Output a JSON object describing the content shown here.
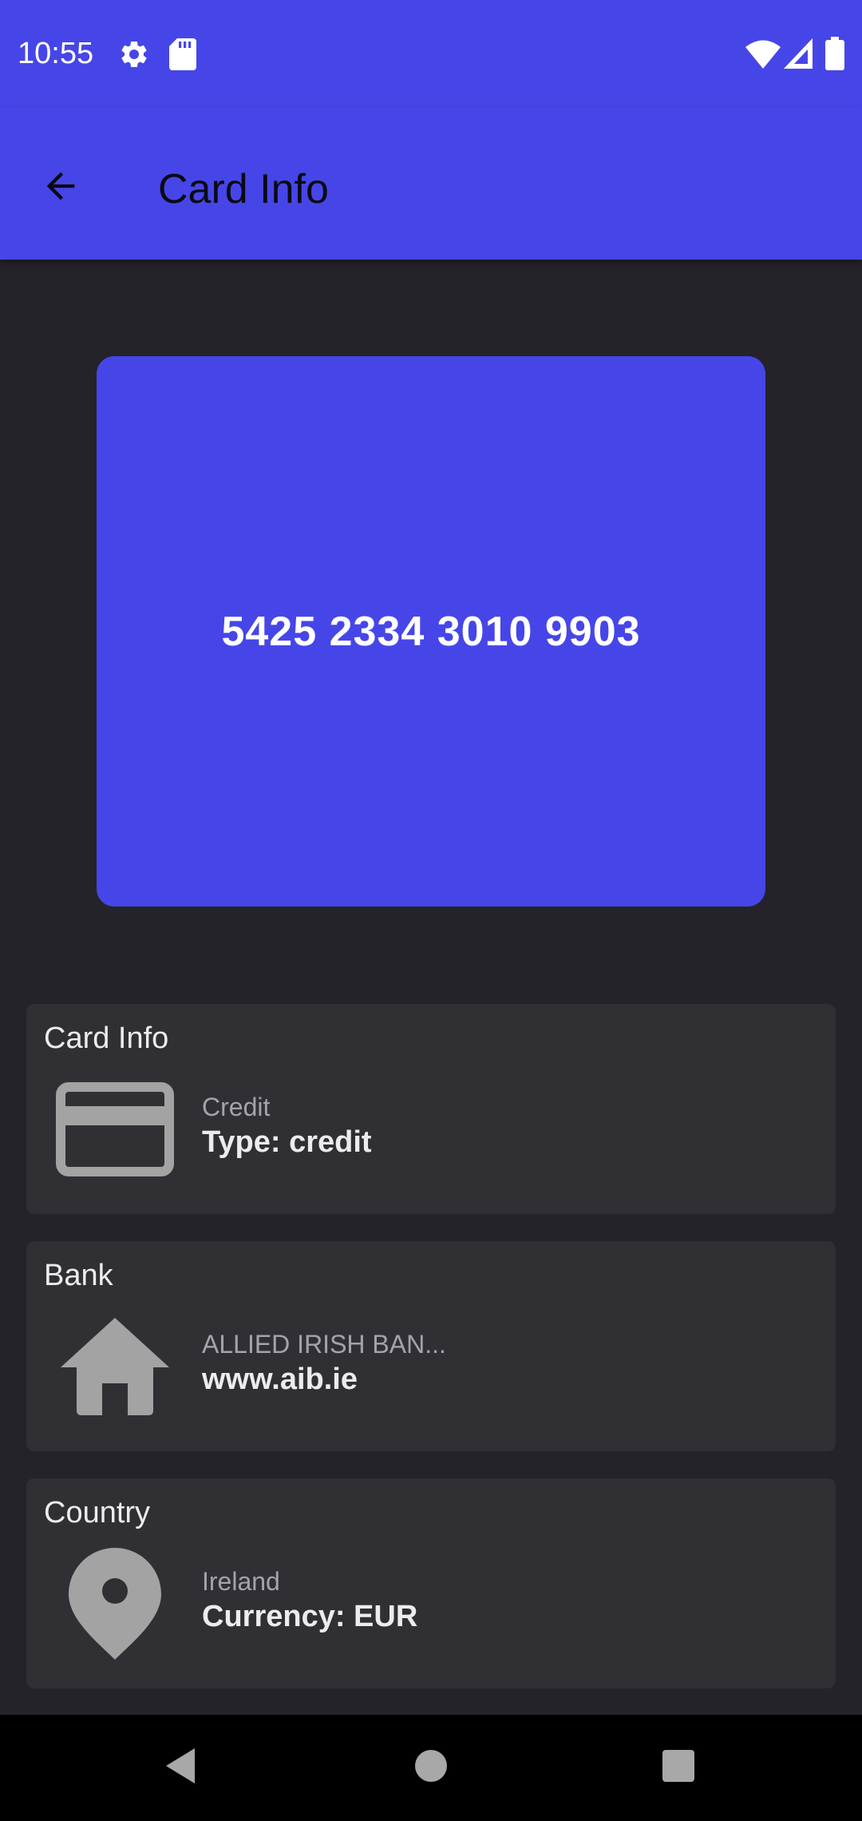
{
  "status_bar": {
    "time": "10:55",
    "icons": [
      "gear-icon",
      "sd-card-icon",
      "wifi-icon",
      "signal-icon",
      "battery-icon"
    ]
  },
  "app_bar": {
    "title": "Card Info",
    "back_icon": "arrow-left-icon"
  },
  "card": {
    "number": "5425 2334 3010 9903",
    "color": "#4646E8"
  },
  "panels": [
    {
      "heading": "Card Info",
      "icon": "credit-card-icon",
      "subtitle": "Credit",
      "main": "Type: credit"
    },
    {
      "heading": "Bank",
      "icon": "home-icon",
      "subtitle": "ALLIED IRISH BAN...",
      "main": "www.aib.ie"
    },
    {
      "heading": "Country",
      "icon": "location-pin-icon",
      "subtitle": "Ireland",
      "main": "Currency: EUR"
    }
  ],
  "nav_bar": {
    "icons": [
      "back-triangle-icon",
      "home-circle-icon",
      "recents-square-icon"
    ]
  },
  "colors": {
    "accent": "#4646E8",
    "background": "#242329",
    "panel": "#303034",
    "icon_gray": "#A3A3A3"
  }
}
